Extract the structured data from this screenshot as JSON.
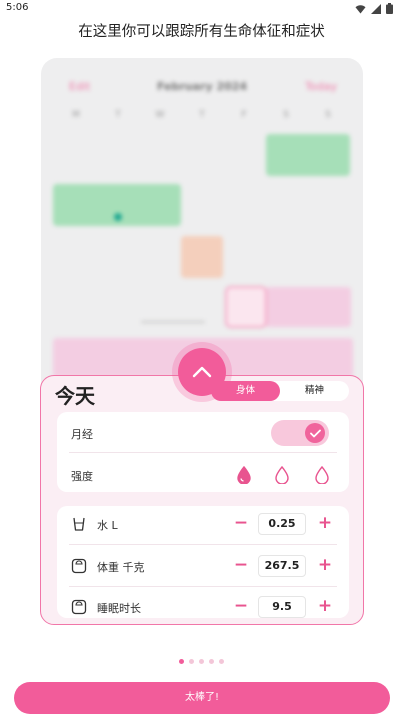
{
  "status_bar": {
    "time": "5:06"
  },
  "headline": "在这里你可以跟踪所有生命体征和症状",
  "calendar": {
    "edit_label": "Edit",
    "month_label": "February 2024",
    "today_label": "Today",
    "weekdays": [
      "M",
      "T",
      "W",
      "T",
      "F",
      "S",
      "S"
    ]
  },
  "panel": {
    "title": "今天",
    "tabs": [
      {
        "label": "身体",
        "active": true
      },
      {
        "label": "精神",
        "active": false
      }
    ],
    "period_label": "月经",
    "period_on": true,
    "intensity_label": "强度",
    "intensity_levels": 3,
    "metrics": [
      {
        "icon": "water-glass-icon",
        "label": "水 L",
        "value": "0.25"
      },
      {
        "icon": "scale-icon",
        "label": "体重 千克",
        "value": "267.5"
      },
      {
        "icon": "scale-icon",
        "label": "睡眠时长",
        "value": "9.5"
      }
    ],
    "minus_symbol": "−",
    "plus_symbol": "+"
  },
  "pager": {
    "count": 5,
    "active_index": 0
  },
  "cta_label": "太棒了!",
  "colors": {
    "accent": "#f25c9a",
    "accent_light": "#f8c8dc",
    "panel_bg": "#fbeef4",
    "green_band": "#a6dfb8",
    "pink_band": "#f3cde2"
  }
}
